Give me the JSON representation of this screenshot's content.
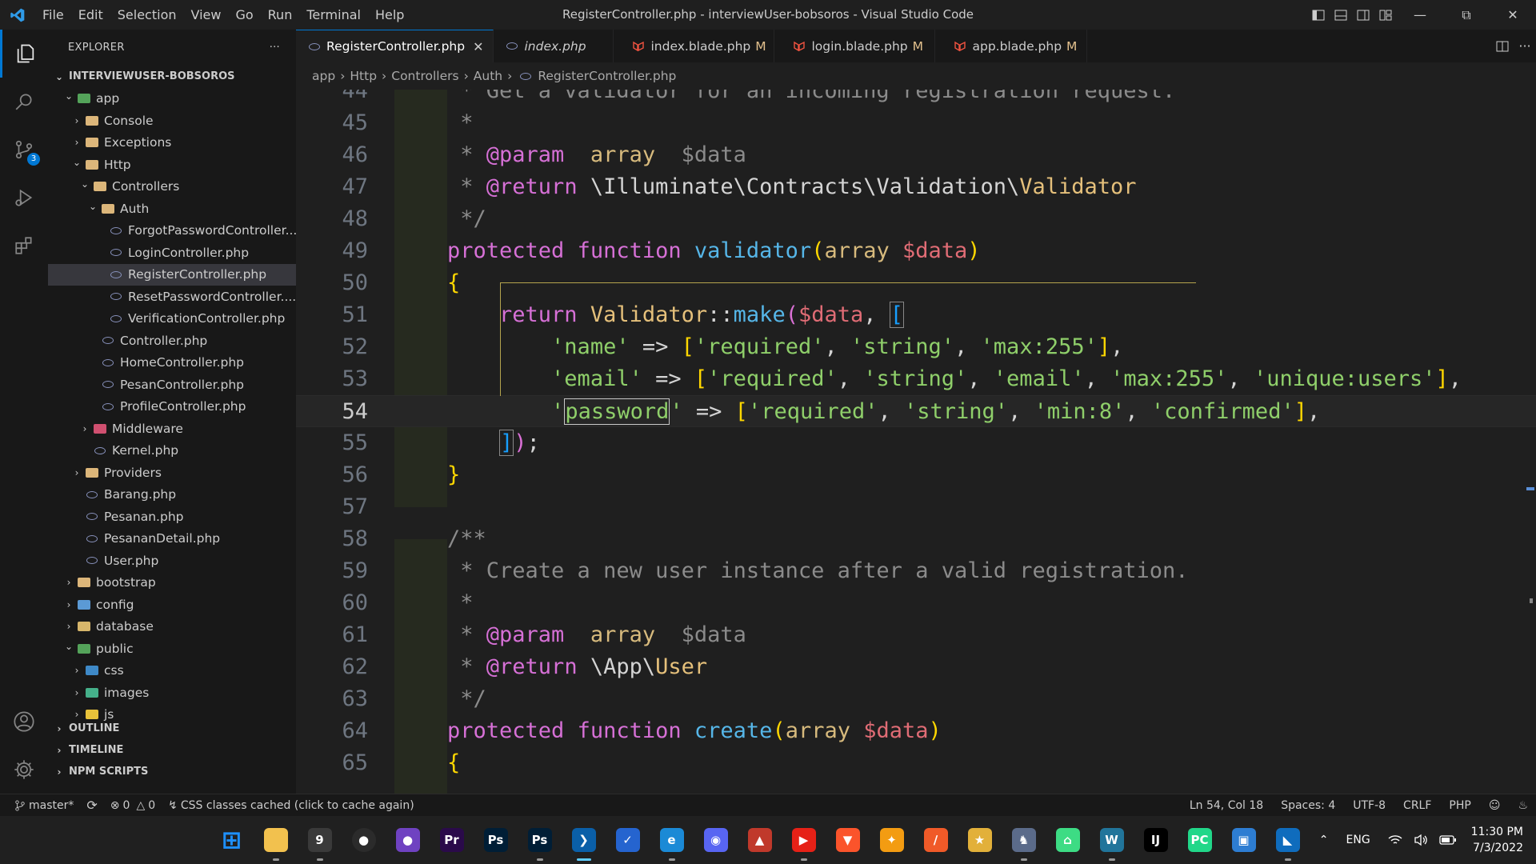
{
  "window": {
    "title": "RegisterController.php - interviewUser-bobsoros - Visual Studio Code",
    "menu": [
      "File",
      "Edit",
      "Selection",
      "View",
      "Go",
      "Run",
      "Terminal",
      "Help"
    ]
  },
  "activity_bar": {
    "items": [
      "explorer",
      "search",
      "source-control",
      "run-debug",
      "extensions"
    ],
    "scm_badge": "3"
  },
  "explorer": {
    "header": "EXPLORER",
    "more": "···",
    "root": "INTERVIEWUSER-BOBSOROS",
    "tree": [
      {
        "label": "app",
        "depth": 1,
        "type": "folder",
        "open": true
      },
      {
        "label": "Console",
        "depth": 2,
        "type": "folder",
        "open": false
      },
      {
        "label": "Exceptions",
        "depth": 2,
        "type": "folder",
        "open": false
      },
      {
        "label": "Http",
        "depth": 2,
        "type": "folder",
        "open": true
      },
      {
        "label": "Controllers",
        "depth": 3,
        "type": "folder",
        "open": true
      },
      {
        "label": "Auth",
        "depth": 4,
        "type": "folder",
        "open": true
      },
      {
        "label": "ForgotPasswordController...",
        "depth": 5,
        "type": "php"
      },
      {
        "label": "LoginController.php",
        "depth": 5,
        "type": "php"
      },
      {
        "label": "RegisterController.php",
        "depth": 5,
        "type": "php",
        "selected": true
      },
      {
        "label": "ResetPasswordController....",
        "depth": 5,
        "type": "php"
      },
      {
        "label": "VerificationController.php",
        "depth": 5,
        "type": "php"
      },
      {
        "label": "Controller.php",
        "depth": 4,
        "type": "php"
      },
      {
        "label": "HomeController.php",
        "depth": 4,
        "type": "php"
      },
      {
        "label": "PesanController.php",
        "depth": 4,
        "type": "php"
      },
      {
        "label": "ProfileController.php",
        "depth": 4,
        "type": "php"
      },
      {
        "label": "Middleware",
        "depth": 3,
        "type": "folder",
        "open": false
      },
      {
        "label": "Kernel.php",
        "depth": 3,
        "type": "php"
      },
      {
        "label": "Providers",
        "depth": 2,
        "type": "folder",
        "open": false
      },
      {
        "label": "Barang.php",
        "depth": 2,
        "type": "php"
      },
      {
        "label": "Pesanan.php",
        "depth": 2,
        "type": "php"
      },
      {
        "label": "PesananDetail.php",
        "depth": 2,
        "type": "php"
      },
      {
        "label": "User.php",
        "depth": 2,
        "type": "php"
      },
      {
        "label": "bootstrap",
        "depth": 1,
        "type": "folder",
        "open": false
      },
      {
        "label": "config",
        "depth": 1,
        "type": "folder",
        "open": false
      },
      {
        "label": "database",
        "depth": 1,
        "type": "folder",
        "open": false
      },
      {
        "label": "public",
        "depth": 1,
        "type": "folder",
        "open": true
      },
      {
        "label": "css",
        "depth": 2,
        "type": "folder",
        "open": false
      },
      {
        "label": "images",
        "depth": 2,
        "type": "folder",
        "open": false
      },
      {
        "label": "js",
        "depth": 2,
        "type": "folder",
        "open": false
      }
    ],
    "sections": [
      "OUTLINE",
      "TIMELINE",
      "NPM SCRIPTS"
    ]
  },
  "tabs": [
    {
      "label": "RegisterController.php",
      "active": true,
      "modified": "",
      "kind": "php"
    },
    {
      "label": "index.php",
      "active": false,
      "preview": true,
      "modified": "",
      "kind": "php"
    },
    {
      "label": "index.blade.php",
      "active": false,
      "modified": "M",
      "kind": "blade"
    },
    {
      "label": "login.blade.php",
      "active": false,
      "modified": "M",
      "kind": "blade"
    },
    {
      "label": "app.blade.php",
      "active": false,
      "modified": "M",
      "kind": "blade"
    }
  ],
  "breadcrumb": [
    "app",
    "Http",
    "Controllers",
    "Auth",
    "RegisterController.php"
  ],
  "editor": {
    "current_line": 54,
    "line_numbers": [
      "44",
      "45",
      "46",
      "47",
      "48",
      "49",
      "50",
      "51",
      "52",
      "53",
      "54",
      "55",
      "56",
      "57",
      "58",
      "59",
      "60",
      "61",
      "62",
      "63",
      "64",
      "65"
    ]
  },
  "statusbar": {
    "branch": "master*",
    "errors": "0",
    "warnings": "0",
    "message": "CSS classes cached (click to cache again)",
    "position": "Ln 54, Col 18",
    "spaces": "Spaces: 4",
    "encoding": "UTF-8",
    "eol": "CRLF",
    "language": "PHP"
  },
  "taskbar": {
    "apps": [
      "start",
      "file-explorer",
      "app-9",
      "github",
      "github-desktop",
      "premiere",
      "photoshop-a",
      "photoshop-b",
      "vscode",
      "todo",
      "edge",
      "discord",
      "app-hat",
      "youtube",
      "brave",
      "app-git",
      "app-orange",
      "app-star",
      "app-game",
      "android-studio",
      "app-wordpress",
      "intellij",
      "pycharm",
      "app-window",
      "app-photos"
    ],
    "lang": "ENG",
    "time": "11:30 PM",
    "date": "7/3/2022"
  },
  "colors": {
    "accent": "#0078d4",
    "keyword": "#d670d6",
    "function": "#56b6e8",
    "string": "#8fcf6a",
    "comment": "#8b8b8b"
  }
}
